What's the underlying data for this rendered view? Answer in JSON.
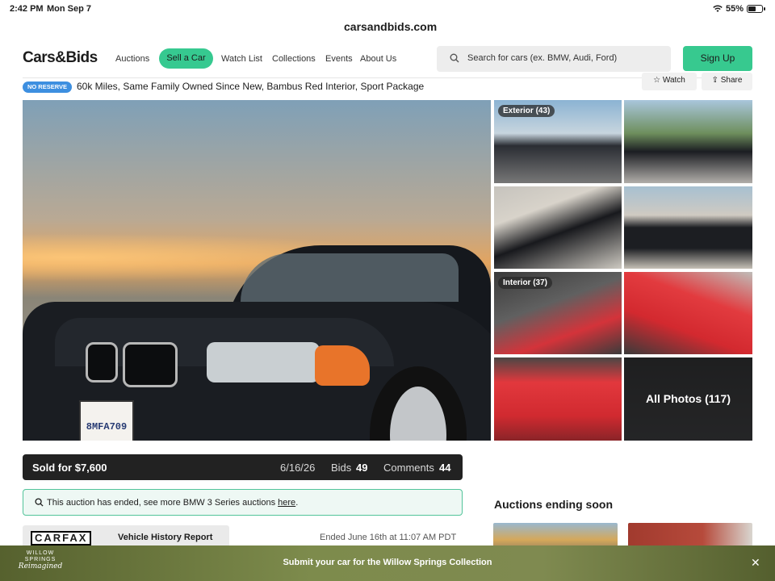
{
  "status_bar": {
    "time": "2:42 PM",
    "date": "Mon Sep 7",
    "battery": "55%"
  },
  "browser": {
    "url": "carsandbids.com"
  },
  "header": {
    "logo": "Cars&Bids",
    "nav": {
      "auctions": "Auctions",
      "sell": "Sell a Car",
      "watch_list": "Watch List",
      "collections": "Collections",
      "events": "Events",
      "about": "About Us"
    },
    "search_placeholder": "Search for cars (ex. BMW, Audi, Ford)",
    "signup": "Sign Up"
  },
  "listing": {
    "badge": "NO RESERVE",
    "title": "60k Miles, Same Family Owned Since New, Bambus Red Interior, Sport Package",
    "watch": "Watch",
    "share": "Share",
    "plate": "8MFA709"
  },
  "gallery": {
    "exterior_label": "Exterior (43)",
    "interior_label": "Interior (37)",
    "all_photos": "All Photos (117)"
  },
  "auction": {
    "sold": "Sold for $7,600",
    "end_date": "6/16/26",
    "bids_label": "Bids",
    "bids": "49",
    "comments_label": "Comments",
    "comments": "44",
    "ended_msg": "This auction has ended, see more BMW 3 Series auctions",
    "ended_link": "here",
    "carfax_logo": "CARFAX",
    "carfax_label": "Vehicle History Report",
    "ended_on": "Ended June 16th at 11:07 AM PDT"
  },
  "sidebar": {
    "ending_soon": "Auctions ending soon"
  },
  "banner": {
    "brand_line1": "WILLOW",
    "brand_line2": "SPRINGS",
    "brand_line3": "Reimagined",
    "message": "Submit your car for the Willow Springs Collection"
  },
  "colors": {
    "accent_green": "#37c98f",
    "badge_blue": "#3d8fe0",
    "sold_bar": "#222222"
  }
}
